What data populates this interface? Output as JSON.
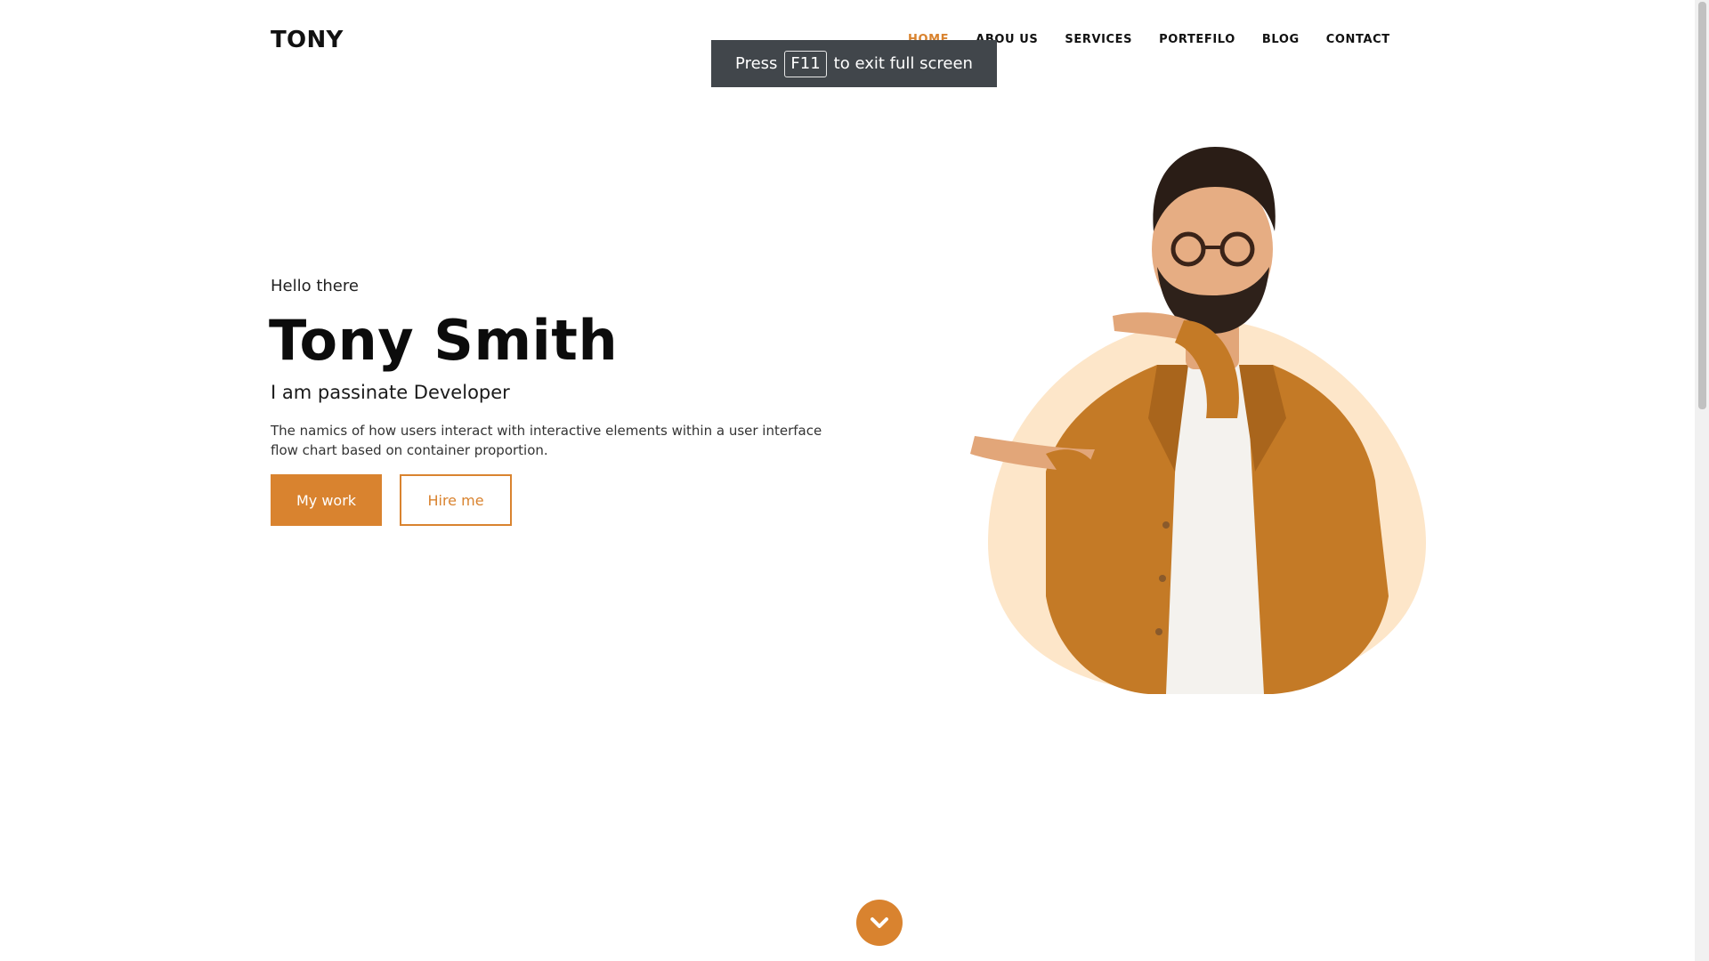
{
  "header": {
    "logo": "TONY",
    "nav": [
      {
        "label": "HOME",
        "active": true
      },
      {
        "label": "ABOU US",
        "active": false
      },
      {
        "label": "SERVICES",
        "active": false
      },
      {
        "label": "PORTEFILO",
        "active": false
      },
      {
        "label": "BLOG",
        "active": false
      },
      {
        "label": "CONTACT",
        "active": false
      }
    ]
  },
  "fullscreen_notice": {
    "prefix": "Press",
    "key": "F11",
    "suffix": "to exit full screen"
  },
  "hero": {
    "greeting": "Hello there",
    "name": "Tony Smith",
    "role": "I am passinate Developer",
    "description": "The namics of how users interact with interactive elements within a user interface flow chart based on container proportion.",
    "primary_button": "My work",
    "secondary_button": "Hire me"
  },
  "icons": {
    "scroll_down": "chevron-down-icon"
  },
  "colors": {
    "accent": "#d9832f",
    "blob": "#fde6c9",
    "toast_bg": "#41464b"
  }
}
